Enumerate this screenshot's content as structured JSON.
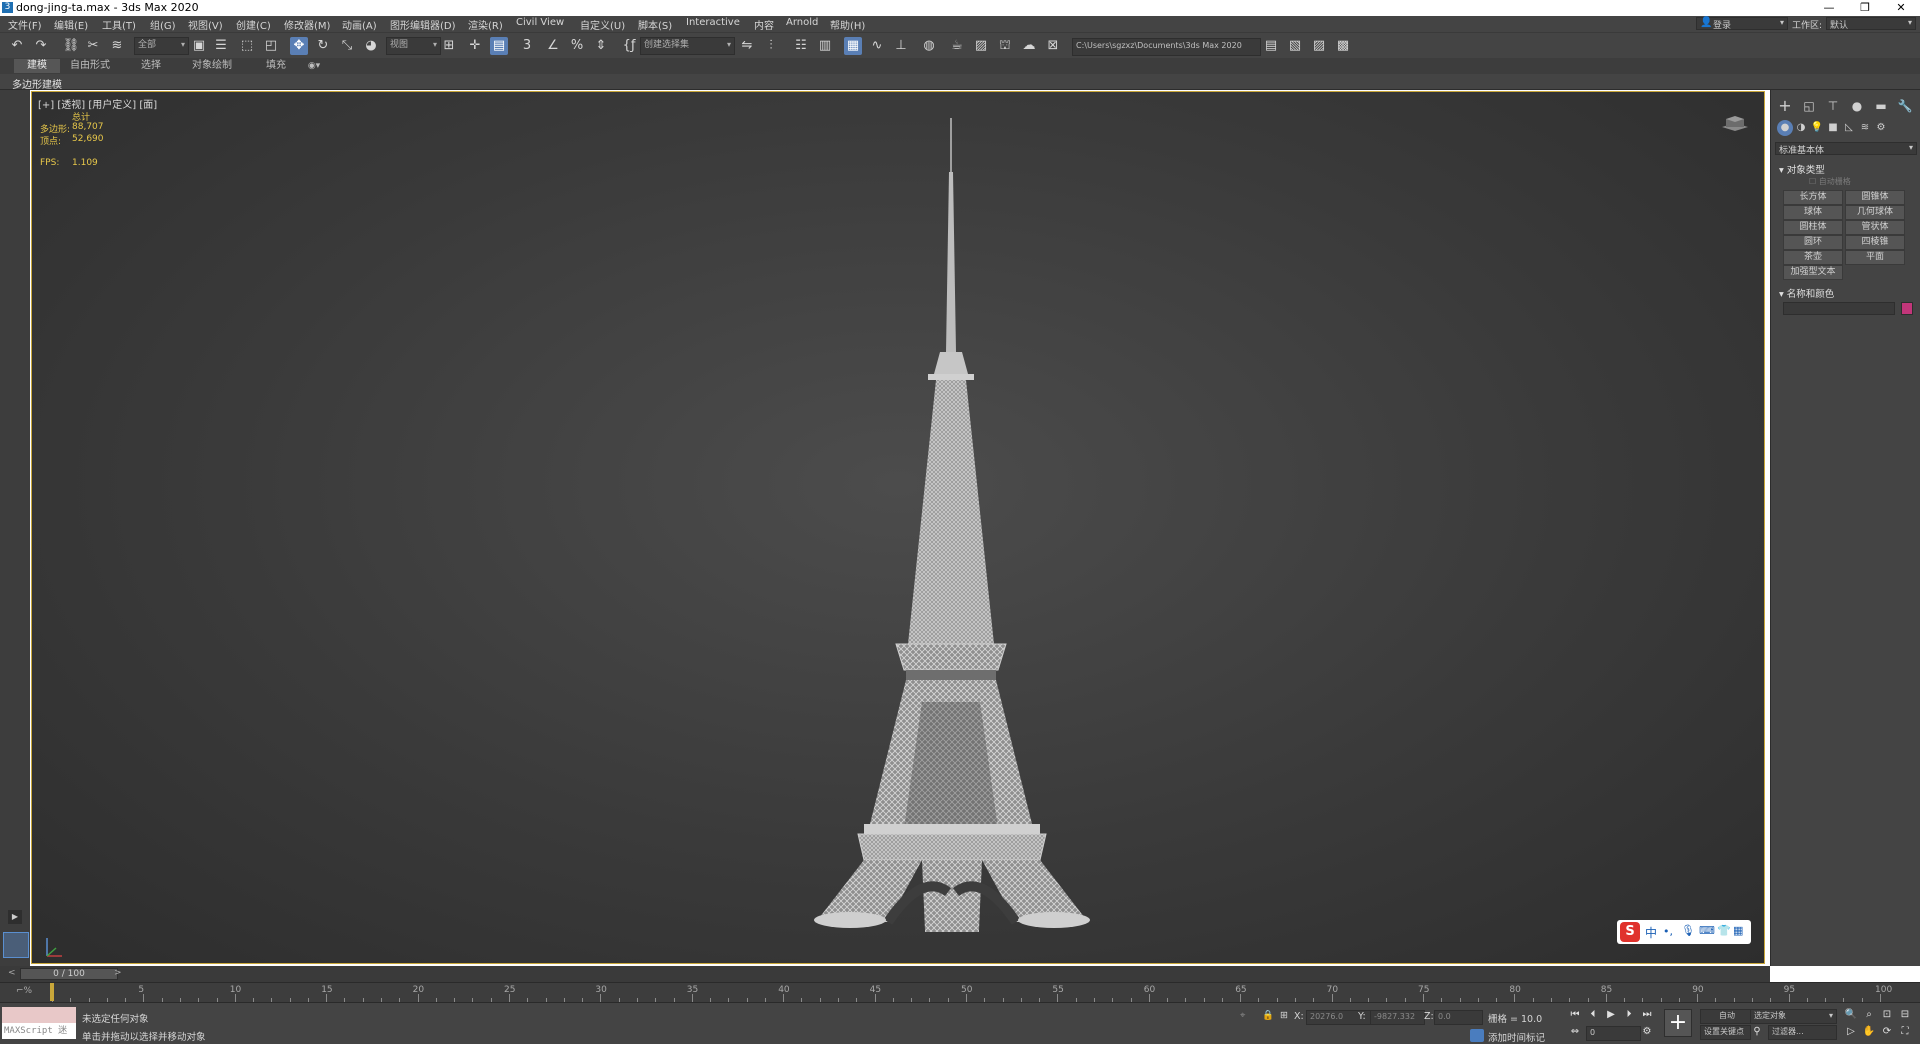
{
  "window": {
    "title": "dong-jing-ta.max - 3ds Max 2020",
    "app_icon": "3",
    "minimize": "—",
    "restore": "❐",
    "close": "✕"
  },
  "menu": {
    "items": [
      "文件(F)",
      "编辑(E)",
      "工具(T)",
      "组(G)",
      "视图(V)",
      "创建(C)",
      "修改器(M)",
      "动画(A)",
      "图形编辑器(D)",
      "渲染(R)",
      "Civil View",
      "自定义(U)",
      "脚本(S)",
      "Interactive",
      "内容",
      "Arnold",
      "帮助(H)"
    ],
    "login": "登录",
    "workspace_label": "工作区:",
    "workspace_value": "默认"
  },
  "toolbar": {
    "selection_filter": "全部",
    "reference_coord": "视图",
    "named_selection": "创建选择集",
    "project_path": "C:\\Users\\sgzxz\\Documents\\3ds Max 2020"
  },
  "ribbon": {
    "tabs": [
      "建模",
      "自由形式",
      "选择",
      "对象绘制",
      "填充"
    ],
    "active_tab": "建模",
    "panel_label": "多边形建模"
  },
  "viewport": {
    "label": "[+] [透视] [用户定义] [面]",
    "stats_header": "总计",
    "polys_label": "多边形:",
    "polys_value": "88,707",
    "verts_label": "顶点:",
    "verts_value": "52,690",
    "fps_label": "FPS:",
    "fps_value": "1.109"
  },
  "command_panel": {
    "category_dropdown": "标准基本体",
    "section_object_type": "对象类型",
    "autogrid": "自动栅格",
    "buttons": [
      "长方体",
      "圆锥体",
      "球体",
      "几何球体",
      "圆柱体",
      "管状体",
      "圆环",
      "四棱锥",
      "茶壶",
      "平面",
      "加强型文本"
    ],
    "section_name_color": "名称和颜色",
    "object_color": "#c2367a"
  },
  "timeline": {
    "frame_display": "0 / 100",
    "ticks": [
      "5",
      "10",
      "15",
      "20",
      "25",
      "30",
      "35",
      "40",
      "45",
      "50",
      "55",
      "60",
      "65",
      "70",
      "75",
      "80",
      "85",
      "90",
      "95",
      "100"
    ]
  },
  "status": {
    "maxscript_label": "MAXScript 迷",
    "line1": "未选定任何对象",
    "line2": "单击并拖动以选择并移动对象",
    "x_label": "X:",
    "x_value": "20276.0",
    "y_label": "Y:",
    "y_value": "-9827.332",
    "z_label": "Z:",
    "z_value": "0.0",
    "grid": "栅格 = 10.0",
    "add_time_tag": "添加时间标记",
    "auto_key": "自动",
    "set_key": "设置关键点",
    "selected_object": "选定对象",
    "filters": "过滤器...",
    "frame_input": "0"
  },
  "ime": {
    "brand": "S",
    "lang": "中"
  }
}
